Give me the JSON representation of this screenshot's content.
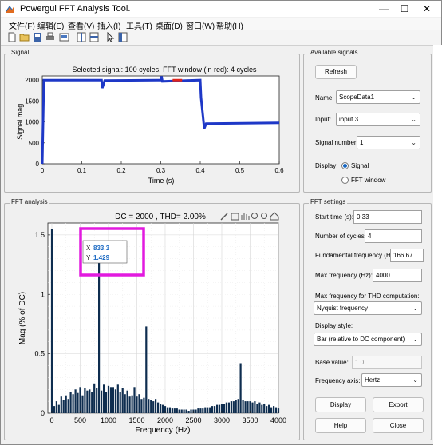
{
  "window": {
    "title": "Powergui FFT Analysis Tool."
  },
  "menu": [
    "文件(F)",
    "编辑(E)",
    "查看(V)",
    "插入(I)",
    "工具(T)",
    "桌面(D)",
    "窗口(W)",
    "帮助(H)"
  ],
  "signal_panel": {
    "title": "Signal",
    "chart_title": "Selected signal: 100 cycles. FFT window (in red): 4 cycles",
    "xlabel": "Time (s)",
    "ylabel": "Signal mag.",
    "xticks": [
      "0",
      "0.1",
      "0.2",
      "0.3",
      "0.4",
      "0.5",
      "0.6"
    ],
    "yticks": [
      "0",
      "500",
      "1000",
      "1500",
      "2000"
    ]
  },
  "fft_panel": {
    "title": "FFT analysis",
    "chart_title": "DC = 2000 , THD= 2.00%",
    "xlabel": "Frequency (Hz)",
    "ylabel": "Mag (% of DC)",
    "xticks": [
      "0",
      "500",
      "1000",
      "1500",
      "2000",
      "2500",
      "3000",
      "3500",
      "4000"
    ],
    "yticks": [
      "0",
      "0.5",
      "1",
      "1.5"
    ],
    "datatip": {
      "x_label": "X",
      "x_value": "833.3",
      "y_label": "Y",
      "y_value": "1.429"
    }
  },
  "available_signals": {
    "title": "Available signals",
    "refresh_label": "Refresh",
    "name_label": "Name:",
    "name_value": "ScopeData1",
    "input_label": "Input:",
    "input_value": "input 3",
    "signal_number_label": "Signal number:",
    "signal_number_value": "1",
    "display_label": "Display:",
    "display_signal_label": "Signal",
    "display_fft_label": "FFT window"
  },
  "fft_settings": {
    "title": "FFT settings",
    "start_time_label": "Start time (s):",
    "start_time_value": "0.33",
    "cycles_label": "Number of cycles:",
    "cycles_value": "4",
    "fund_label": "Fundamental frequency (Hz):",
    "fund_value": "166.67",
    "maxf_label": "Max frequency (Hz):",
    "maxf_value": "4000",
    "thd_label": "Max frequency for THD computation:",
    "thd_value": "Nyquist frequency",
    "style_label": "Display style:",
    "style_value": "Bar (relative to DC component)",
    "base_label": "Base value:",
    "base_value": "1.0",
    "axis_label": "Frequency axis:",
    "axis_value": "Hertz",
    "display_btn": "Display",
    "export_btn": "Export",
    "help_btn": "Help",
    "close_btn": "Close"
  },
  "chart_data": [
    {
      "type": "line",
      "title": "Selected signal: 100 cycles. FFT window (in red): 4 cycles",
      "xlabel": "Time (s)",
      "ylabel": "Signal mag.",
      "xlim": [
        0,
        0.6
      ],
      "ylim": [
        0,
        2100
      ],
      "series": [
        {
          "values": [
            [
              0,
              0
            ],
            [
              0.004,
              2000
            ],
            [
              0.02,
              2000
            ],
            [
              0.15,
              2000
            ],
            [
              0.152,
              1810
            ],
            [
              0.158,
              1990
            ],
            [
              0.29,
              2000
            ],
            [
              0.3,
              2000
            ],
            [
              0.302,
              2090
            ],
            [
              0.304,
              1970
            ],
            [
              0.4,
              2000
            ],
            [
              0.402,
              1580
            ],
            [
              0.41,
              840
            ],
            [
              0.415,
              960
            ],
            [
              0.6,
              980
            ]
          ]
        }
      ],
      "fft_window": [
        0.33,
        0.354
      ]
    },
    {
      "type": "bar",
      "title": "DC = 2000 , THD= 2.00%",
      "xlabel": "Frequency (Hz)",
      "ylabel": "Mag (% of DC)",
      "xlim": [
        -70,
        4000
      ],
      "ylim": [
        0,
        1.6
      ],
      "x": [
        0,
        42,
        83,
        125,
        167,
        208,
        250,
        292,
        333,
        375,
        417,
        458,
        500,
        542,
        583,
        625,
        667,
        708,
        750,
        792,
        833,
        875,
        917,
        958,
        1000,
        1042,
        1083,
        1125,
        1167,
        1208,
        1250,
        1292,
        1333,
        1375,
        1417,
        1458,
        1500,
        1542,
        1583,
        1625,
        1667,
        1708,
        1750,
        1792,
        1833,
        1875,
        1917,
        1958,
        2000,
        2042,
        2083,
        2125,
        2167,
        2208,
        2250,
        2292,
        2333,
        2375,
        2417,
        2458,
        2500,
        2542,
        2583,
        2625,
        2667,
        2708,
        2750,
        2792,
        2833,
        2875,
        2917,
        2958,
        3000,
        3042,
        3083,
        3125,
        3167,
        3208,
        3250,
        3292,
        3333,
        3375,
        3417,
        3458,
        3500,
        3542,
        3583,
        3625,
        3667,
        3708,
        3750,
        3792,
        3833,
        3875,
        3917,
        3958,
        4000
      ],
      "values": [
        1.55,
        0.06,
        0.1,
        0.07,
        0.14,
        0.11,
        0.15,
        0.12,
        0.18,
        0.16,
        0.2,
        0.17,
        0.22,
        0.15,
        0.21,
        0.19,
        0.2,
        0.18,
        0.25,
        0.21,
        1.429,
        0.19,
        0.24,
        0.18,
        0.23,
        0.22,
        0.22,
        0.2,
        0.24,
        0.18,
        0.21,
        0.16,
        0.19,
        0.14,
        0.15,
        0.22,
        0.14,
        0.16,
        0.12,
        0.13,
        0.73,
        0.12,
        0.11,
        0.1,
        0.12,
        0.09,
        0.08,
        0.07,
        0.06,
        0.05,
        0.05,
        0.04,
        0.04,
        0.04,
        0.03,
        0.03,
        0.03,
        0.03,
        0.02,
        0.03,
        0.03,
        0.03,
        0.04,
        0.04,
        0.04,
        0.05,
        0.05,
        0.05,
        0.06,
        0.06,
        0.07,
        0.07,
        0.08,
        0.08,
        0.09,
        0.09,
        0.1,
        0.1,
        0.11,
        0.12,
        0.42,
        0.11,
        0.1,
        0.1,
        0.1,
        0.09,
        0.1,
        0.08,
        0.09,
        0.07,
        0.08,
        0.06,
        0.07,
        0.05,
        0.06,
        0.05,
        0.04
      ]
    }
  ]
}
